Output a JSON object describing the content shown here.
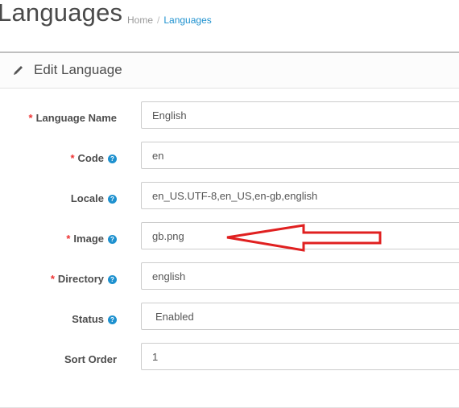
{
  "header": {
    "title": "Languages",
    "breadcrumb": [
      "Home",
      "Languages"
    ]
  },
  "panel": {
    "heading": "Edit Language",
    "icon": "pencil-icon"
  },
  "form": {
    "fields": [
      {
        "label": "Language Name",
        "required": true,
        "help": false,
        "value": "English"
      },
      {
        "label": "Code",
        "required": true,
        "help": true,
        "value": "en"
      },
      {
        "label": "Locale",
        "required": false,
        "help": true,
        "value": "en_US.UTF-8,en_US,en-gb,english"
      },
      {
        "label": "Image",
        "required": true,
        "help": true,
        "value": "gb.png"
      },
      {
        "label": "Directory",
        "required": true,
        "help": true,
        "value": "english"
      },
      {
        "label": "Status",
        "required": false,
        "help": true,
        "value": "Enabled"
      },
      {
        "label": "Sort Order",
        "required": false,
        "help": false,
        "value": "1"
      }
    ]
  },
  "colors": {
    "required": "#ee3333",
    "help": "#1e91cf",
    "link": "#1e91cf",
    "annotation_arrow": "#e02020"
  },
  "help_icon_glyph": "?",
  "required_marker": "*"
}
